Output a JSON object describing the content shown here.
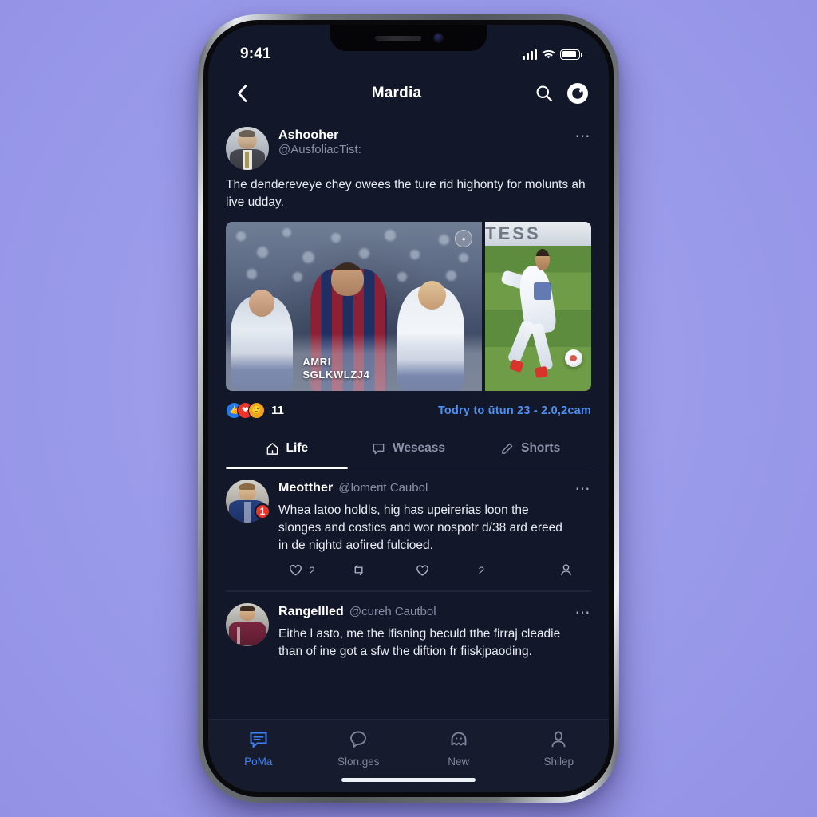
{
  "background_color": "#9a9aea",
  "device": {
    "frame_color": "#6e7379",
    "screen_bg": "#121729"
  },
  "statusbar": {
    "time": "9:41",
    "signal_icon": "cellular-signal-icon",
    "wifi_icon": "wifi-icon",
    "battery_icon": "battery-icon"
  },
  "header": {
    "back_icon": "chevron-left-icon",
    "title": "Mardia",
    "search_icon": "search-icon",
    "profile_icon": "profile-avatar-icon"
  },
  "featured_post": {
    "author_name": "Ashooher",
    "author_handle": "@AusfoliacTist:",
    "more_icon": "more-options-icon",
    "text": "The dendereveye chey owees the ture rid highonty for molunts ah live udday.",
    "media": {
      "main_caption_line1": "AMRI",
      "main_caption_line2": "SGLKWLZJ4",
      "watermark": "watermark-icon",
      "side_board_text": "TESS"
    },
    "reactions": {
      "pills": [
        {
          "name": "reaction-like",
          "color": "#1f7aeb",
          "glyph": "●"
        },
        {
          "name": "reaction-love",
          "color": "#e8352e",
          "glyph": "♥"
        },
        {
          "name": "reaction-wow",
          "color": "#f2a321",
          "glyph": "●"
        }
      ],
      "count": "11",
      "link_text": "Todry to ūtun 23 -  2.0,2cam"
    }
  },
  "tabs": [
    {
      "label": "Life",
      "icon": "home-outline-icon",
      "active": true
    },
    {
      "label": "Weseass",
      "icon": "comment-bubble-icon",
      "active": false
    },
    {
      "label": "Shorts",
      "icon": "pencil-icon",
      "active": false
    }
  ],
  "posts": [
    {
      "name": "Meotther",
      "handle": "@lomerit Caubol",
      "badge": "1",
      "more_icon": "more-options-icon",
      "text": "Whea latoo holdls, hig has upeirerias loon the slonges and costics and wor nospotr d/38 ard ereed in de nightd aofired fulcioed.",
      "actions": [
        {
          "icon": "comment-heart-icon",
          "name": "reply-action",
          "value": "2"
        },
        {
          "icon": "retweet-icon",
          "name": "repost-action",
          "value": ""
        },
        {
          "icon": "heart-icon",
          "name": "like-action",
          "value": ""
        },
        {
          "icon": "count-label",
          "name": "view-count",
          "value": "2"
        },
        {
          "icon": "person-icon",
          "name": "share-action",
          "value": ""
        }
      ]
    },
    {
      "name": "Rangellled",
      "handle": "@cureh Cautbol",
      "badge": "",
      "more_icon": "more-options-icon",
      "text": "Eithe l asto, me the lfisning beculd tthe firraj cleadie than of ine got a sfw the diftion fr fiiskjpaoding.",
      "actions": []
    }
  ],
  "bottomnav": [
    {
      "label": "PoMa",
      "icon": "message-square-icon",
      "active": true
    },
    {
      "label": "Slon.ges",
      "icon": "chat-bubble-icon",
      "active": false
    },
    {
      "label": "New",
      "icon": "ghost-icon",
      "active": false
    },
    {
      "label": "Shilep",
      "icon": "person-outline-icon",
      "active": false
    }
  ],
  "accent_color": "#3b82f6",
  "link_color": "#4f8ff0"
}
